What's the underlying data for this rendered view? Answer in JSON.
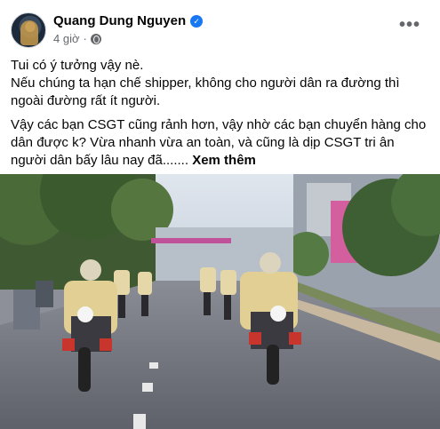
{
  "post": {
    "author_name": "Quang Dung Nguyen",
    "time_ago": "4 giờ",
    "separator": "·",
    "verified_glyph": "✓",
    "more_glyph": "•••",
    "paragraph_1_line_1": "Tui có ý tưởng vậy nè.",
    "paragraph_1_line_2": "Nếu chúng ta hạn chế shipper, không cho người dân ra đường thì ngoài đường rất ít người.",
    "paragraph_2": "Vậy các bạn CSGT cũng rảnh hơn, vậy nhờ các bạn chuyển hàng cho dân được k? Vừa nhanh vừa an toàn, và cũng là dịp CSGT tri ân người dân bấy lâu nay đã.......",
    "see_more": "Xem thêm"
  },
  "icons": {
    "verified": "verified-badge-icon",
    "audience": "globe-icon",
    "more": "more-options-icon"
  },
  "colors": {
    "brand_blue": "#1877f2",
    "secondary_text": "#65676b",
    "primary_text": "#050505"
  }
}
